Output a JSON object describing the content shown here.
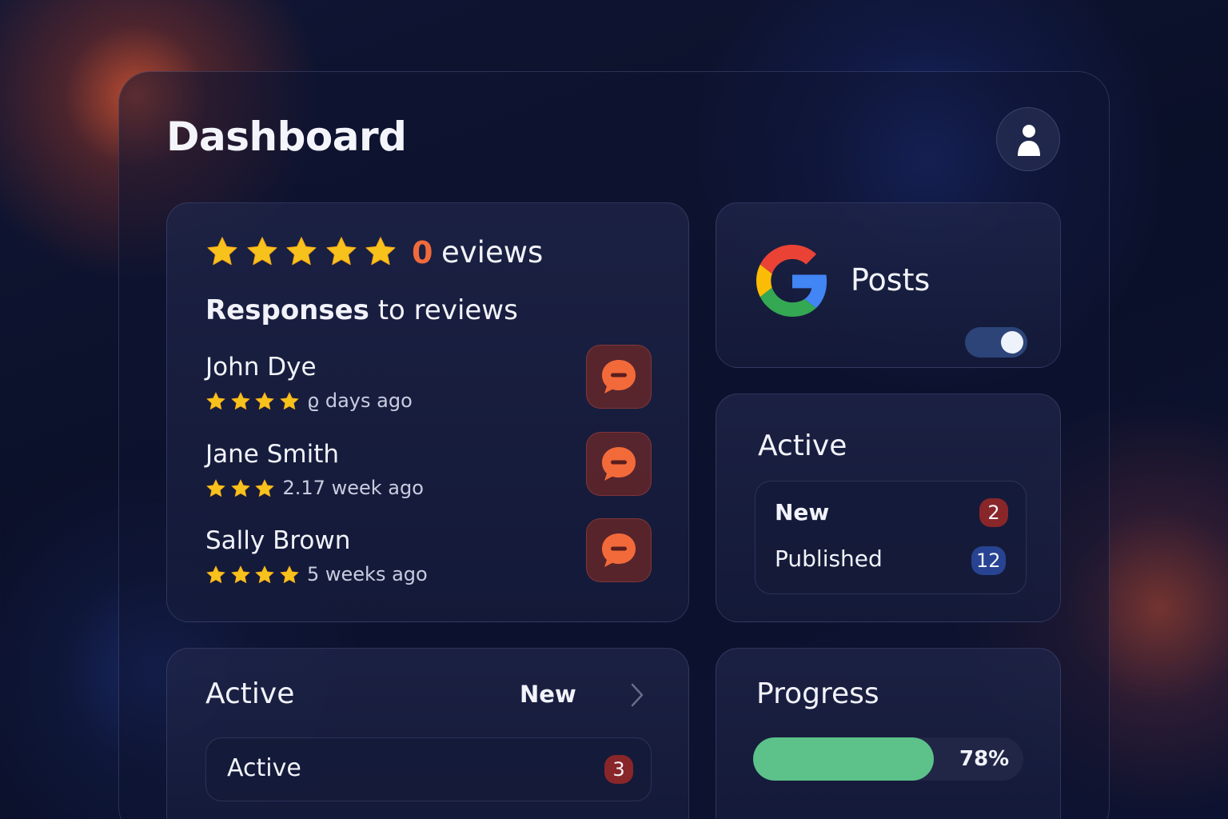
{
  "header": {
    "title": "Dashboard",
    "avatar_icon": "user-icon"
  },
  "reviews": {
    "rating_stars": 5,
    "count": "0",
    "count_label": "eviews",
    "heading_bold": "Responses",
    "heading_rest": " to reviews",
    "items": [
      {
        "name": "John Dye",
        "stars": 4,
        "time": "ϱ days ago",
        "reply_icon": "chat-bubble-icon"
      },
      {
        "name": "Jane Smith",
        "stars": 3,
        "time": "2.17 week ago",
        "reply_icon": "chat-bubble-icon"
      },
      {
        "name": "Sally Brown",
        "stars": 4,
        "time": "5 weeks ago",
        "reply_icon": "chat-bubble-icon"
      }
    ]
  },
  "posts": {
    "icon": "google-icon",
    "label": "Posts",
    "toggle_on": true
  },
  "active_status": {
    "title": "Active",
    "rows": [
      {
        "label": "New",
        "count": "2",
        "color": "#962828"
      },
      {
        "label": "Published",
        "count": "12",
        "color": "#284696"
      }
    ]
  },
  "active_panel": {
    "title": "Active",
    "link_label": "New",
    "row_label": "Active",
    "row_count": "3"
  },
  "progress": {
    "title": "Progress",
    "value": 78,
    "label": "78%",
    "color": "#5cc28a"
  },
  "colors": {
    "accent_orange": "#f06a3c",
    "star_yellow": "#f8c21c",
    "background": "#0b1029"
  }
}
